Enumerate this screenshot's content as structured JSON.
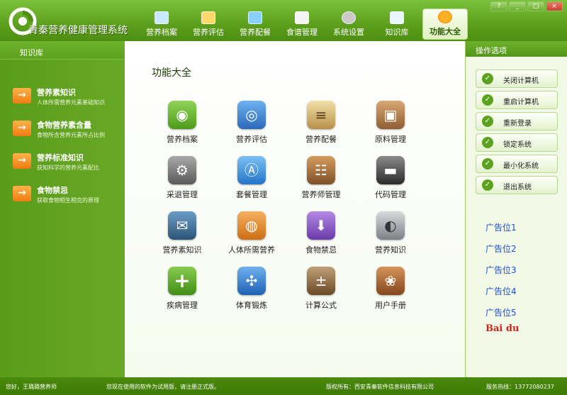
{
  "app": {
    "title": "青秦营养健康管理系统"
  },
  "window_controls": [
    "?",
    "_",
    "□",
    "×"
  ],
  "nav": [
    {
      "label": "营养档案",
      "icon": "profile-icon"
    },
    {
      "label": "营养评估",
      "icon": "assessment-icon"
    },
    {
      "label": "营养配餐",
      "icon": "meal-plan-icon"
    },
    {
      "label": "食谱管理",
      "icon": "recipe-icon"
    },
    {
      "label": "系统设置",
      "icon": "gear-icon"
    },
    {
      "label": "知识库",
      "icon": "knowledge-icon"
    },
    {
      "label": "功能大全",
      "icon": "sunflower-icon",
      "active": true
    }
  ],
  "sidebar": {
    "header": "知识库",
    "items": [
      {
        "title": "营养素知识",
        "desc": "人体所需营养元素基础知识"
      },
      {
        "title": "食物营养素含量",
        "desc": "食物所含营养元素所占比例"
      },
      {
        "title": "营养标准知识",
        "desc": "获知科学的营养元素配比"
      },
      {
        "title": "食物禁忌",
        "desc": "获取食物相生相克的原理"
      }
    ]
  },
  "main": {
    "title": "功能大全",
    "apps": [
      {
        "label": "营养档案",
        "icon": "message-bubbles-icon",
        "color": "#6bb32e"
      },
      {
        "label": "营养评估",
        "icon": "owl-icon",
        "color": "#3d7fd1"
      },
      {
        "label": "营养配餐",
        "icon": "notepad-icon",
        "color": "#c9a860"
      },
      {
        "label": "原料管理",
        "icon": "photo-corkboard-icon",
        "color": "#b9885a"
      },
      {
        "label": "采退管理",
        "icon": "gear-icon",
        "color": "#7c7c7c"
      },
      {
        "label": "套餐管理",
        "icon": "app-store-icon",
        "color": "#3b8fd8"
      },
      {
        "label": "营养师管理",
        "icon": "address-book-icon",
        "color": "#a8743d"
      },
      {
        "label": "代码管理",
        "icon": "dark-square-icon",
        "color": "#4a4a4a"
      },
      {
        "label": "营养素知识",
        "icon": "tweet-bubble-icon",
        "color": "#3c6f9c"
      },
      {
        "label": "人体所需营养",
        "icon": "ipod-icon",
        "color": "#e08a2a"
      },
      {
        "label": "食物禁忌",
        "icon": "download-icon",
        "color": "#8a5ac2"
      },
      {
        "label": "营养知识",
        "icon": "safe-icon",
        "color": "#8e9294"
      },
      {
        "label": "疾病管理",
        "icon": "plus-icon",
        "color": "#5ba629"
      },
      {
        "label": "体育锻炼",
        "icon": "compass-icon",
        "color": "#2f78c9"
      },
      {
        "label": "计算公式",
        "icon": "calculator-icon",
        "color": "#8c6a3f"
      },
      {
        "label": "用户手册",
        "icon": "manual-icon",
        "color": "#a86a3a"
      }
    ]
  },
  "right_panel": {
    "header": "操作选项",
    "buttons": [
      "关闭计算机",
      "重启计算机",
      "重新登录",
      "锁定系统",
      "最小化系统",
      "退出系统"
    ],
    "ads": [
      "广告位1",
      "广告位2",
      "广告位3",
      "广告位4",
      "广告位5"
    ],
    "sponsor": "Bai du"
  },
  "status": {
    "greeting": "您好，王璐璐营养师",
    "trial_notice": "您现在使用的软件为试用版，请注册正式版。",
    "copyright": "版权所有：西安青秦软件信息科技有限公司",
    "hotline": "服务热线：13772080237"
  }
}
